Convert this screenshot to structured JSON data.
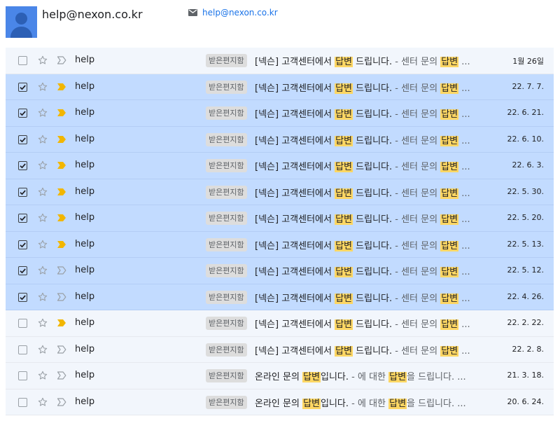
{
  "sender": {
    "name": "help@nexon.co.kr",
    "email": "help@nexon.co.kr",
    "avatar_icon": "person-icon",
    "email_icon": "envelope-icon"
  },
  "colors": {
    "selected_row": "#c2dbff",
    "unselected_row": "#f2f6fc",
    "highlight": "#fdd663",
    "important_marker": "#f2b600",
    "link": "#1a73e8"
  },
  "emails": [
    {
      "selected": false,
      "important": false,
      "from": "help",
      "label": "받은편지함",
      "subject_parts": [
        "[넥슨] 고객센터에서 ",
        "답변",
        " 드립니다."
      ],
      "snippet_parts": [
        " - 센터 문의 ",
        "답변",
        " ..."
      ],
      "date": "1월 26일"
    },
    {
      "selected": true,
      "important": true,
      "from": "help",
      "label": "받은편지함",
      "subject_parts": [
        "[넥슨] 고객센터에서 ",
        "답변",
        " 드립니다."
      ],
      "snippet_parts": [
        " - 센터 문의 ",
        "답변",
        " ..."
      ],
      "date": "22. 7. 7."
    },
    {
      "selected": true,
      "important": true,
      "from": "help",
      "label": "받은편지함",
      "subject_parts": [
        "[넥슨] 고객센터에서 ",
        "답변",
        " 드립니다."
      ],
      "snippet_parts": [
        " - 센터 문의 ",
        "답변",
        " ..."
      ],
      "date": "22. 6. 21."
    },
    {
      "selected": true,
      "important": true,
      "from": "help",
      "label": "받은편지함",
      "subject_parts": [
        "[넥슨] 고객센터에서 ",
        "답변",
        " 드립니다."
      ],
      "snippet_parts": [
        " - 센터 문의 ",
        "답변",
        " ..."
      ],
      "date": "22. 6. 10."
    },
    {
      "selected": true,
      "important": true,
      "from": "help",
      "label": "받은편지함",
      "subject_parts": [
        "[넥슨] 고객센터에서 ",
        "답변",
        " 드립니다."
      ],
      "snippet_parts": [
        " - 센터 문의 ",
        "답변",
        " ..."
      ],
      "date": "22. 6. 3."
    },
    {
      "selected": true,
      "important": true,
      "from": "help",
      "label": "받은편지함",
      "subject_parts": [
        "[넥슨] 고객센터에서 ",
        "답변",
        " 드립니다."
      ],
      "snippet_parts": [
        " - 센터 문의 ",
        "답변",
        " ..."
      ],
      "date": "22. 5. 30."
    },
    {
      "selected": true,
      "important": true,
      "from": "help",
      "label": "받은편지함",
      "subject_parts": [
        "[넥슨] 고객센터에서 ",
        "답변",
        " 드립니다."
      ],
      "snippet_parts": [
        " - 센터 문의 ",
        "답변",
        " ..."
      ],
      "date": "22. 5. 20."
    },
    {
      "selected": true,
      "important": true,
      "from": "help",
      "label": "받은편지함",
      "subject_parts": [
        "[넥슨] 고객센터에서 ",
        "답변",
        " 드립니다."
      ],
      "snippet_parts": [
        " - 센터 문의 ",
        "답변",
        " ..."
      ],
      "date": "22. 5. 13."
    },
    {
      "selected": true,
      "important": false,
      "from": "help",
      "label": "받은편지함",
      "subject_parts": [
        "[넥슨] 고객센터에서 ",
        "답변",
        " 드립니다."
      ],
      "snippet_parts": [
        " - 센터 문의 ",
        "답변",
        " ..."
      ],
      "date": "22. 5. 12."
    },
    {
      "selected": true,
      "important": false,
      "from": "help",
      "label": "받은편지함",
      "subject_parts": [
        "[넥슨] 고객센터에서 ",
        "답변",
        " 드립니다."
      ],
      "snippet_parts": [
        " - 센터 문의 ",
        "답변",
        " ..."
      ],
      "date": "22. 4. 26."
    },
    {
      "selected": false,
      "important": true,
      "from": "help",
      "label": "받은편지함",
      "subject_parts": [
        "[넥슨] 고객센터에서 ",
        "답변",
        " 드립니다."
      ],
      "snippet_parts": [
        " - 센터 문의 ",
        "답변",
        " ..."
      ],
      "date": "22. 2. 22."
    },
    {
      "selected": false,
      "important": false,
      "from": "help",
      "label": "받은편지함",
      "subject_parts": [
        "[넥슨] 고객센터에서 ",
        "답변",
        " 드립니다."
      ],
      "snippet_parts": [
        " - 센터 문의 ",
        "답변",
        " ..."
      ],
      "date": "22. 2. 8."
    },
    {
      "selected": false,
      "important": false,
      "from": "help",
      "label": "받은편지함",
      "subject_parts": [
        "온라인 문의 ",
        "답변",
        "입니다."
      ],
      "snippet_parts": [
        " - 에 대한 ",
        "답변",
        "을 드립니다. ..."
      ],
      "date": "21. 3. 18."
    },
    {
      "selected": false,
      "important": false,
      "from": "help",
      "label": "받은편지함",
      "subject_parts": [
        "온라인 문의 ",
        "답변",
        "입니다."
      ],
      "snippet_parts": [
        " - 에 대한 ",
        "답변",
        "을 드립니다. ..."
      ],
      "date": "20. 6. 24."
    }
  ]
}
